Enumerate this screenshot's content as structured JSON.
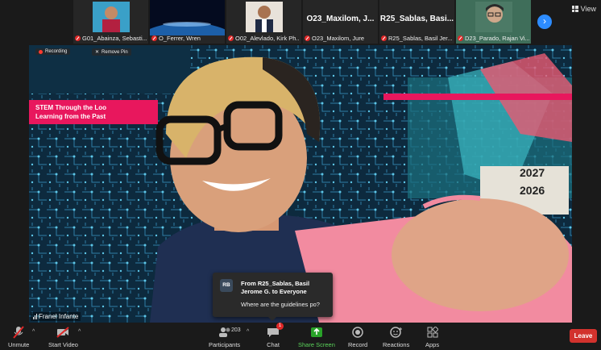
{
  "top_bar": {
    "view_label": "View"
  },
  "thumbnails": [
    {
      "name": "G01_Abainza, Sebasti...",
      "display_name": "",
      "muted": true,
      "kind": "photo"
    },
    {
      "name": "O_Ferrer, Wren",
      "display_name": "",
      "muted": true,
      "kind": "earth"
    },
    {
      "name": "O02_Alevlado, Kirk Ph...",
      "display_name": "",
      "muted": true,
      "kind": "photo"
    },
    {
      "name": "O23_Maxilom, Jure",
      "display_name": "O23_Maxilom, J...",
      "muted": true,
      "kind": "text"
    },
    {
      "name": "R25_Sablas, Basil Jer...",
      "display_name": "R25_Sablas, Basi...",
      "muted": true,
      "kind": "text"
    },
    {
      "name": "D23_Parado, Rajan Vi...",
      "display_name": "",
      "muted": true,
      "kind": "photo"
    }
  ],
  "main_video": {
    "recording_label": "Recording",
    "remove_label": "Remove Pin",
    "banner_text_line1": "STEM Through the Loo",
    "banner_text_line2": "Learning from the Past",
    "year_top": "2027",
    "year_bottom": "2026",
    "speaker_name": "Franel Infante"
  },
  "chat_popup": {
    "avatar_initials": "RB",
    "from_line": "From R25_Sablas, Basil Jerome G. to Everyone",
    "message": "Where are the guidelines po?"
  },
  "toolbar": {
    "unmute": "Unmute",
    "start_video": "Start Video",
    "participants": "Participants",
    "participant_count": "203",
    "chat": "Chat",
    "chat_badge": "1",
    "share_screen": "Share Screen",
    "record": "Record",
    "reactions": "Reactions",
    "apps": "Apps",
    "leave": "Leave"
  },
  "colors": {
    "accent_blue": "#2d8cff",
    "leave_red": "#d2322d",
    "share_green": "#5ad45a",
    "banner_pink": "#e8175d"
  }
}
